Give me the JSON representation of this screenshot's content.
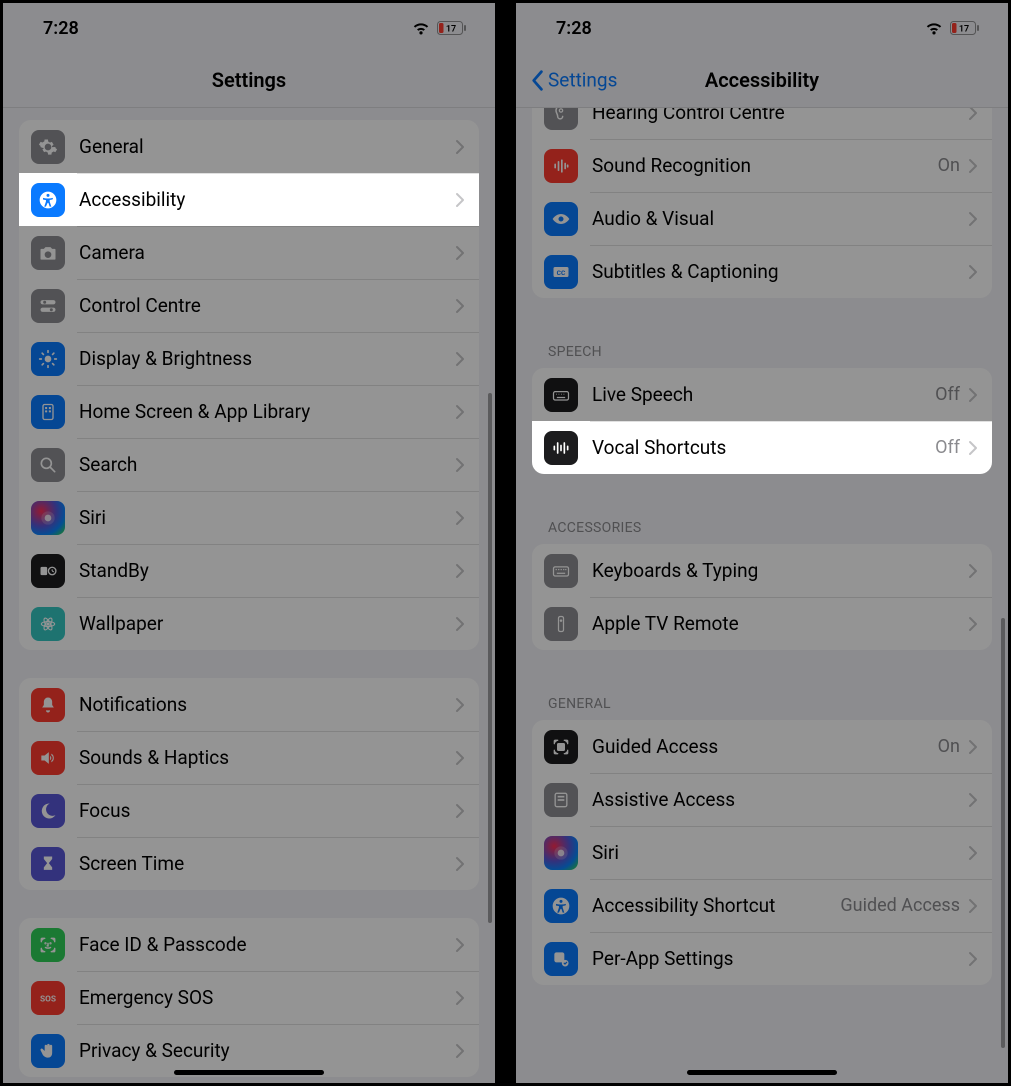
{
  "status": {
    "time": "7:28",
    "battery": "17"
  },
  "left": {
    "title": "Settings",
    "groups": [
      [
        {
          "icon": "gear",
          "color": "c-gray",
          "label": "General"
        },
        {
          "icon": "access",
          "color": "c-blue",
          "label": "Accessibility",
          "highlight": true
        },
        {
          "icon": "camera",
          "color": "c-gray",
          "label": "Camera"
        },
        {
          "icon": "toggles",
          "color": "c-gray",
          "label": "Control Centre"
        },
        {
          "icon": "brightness",
          "color": "c-blue",
          "label": "Display & Brightness"
        },
        {
          "icon": "home",
          "color": "c-blue",
          "label": "Home Screen & App Library"
        },
        {
          "icon": "search",
          "color": "c-gray",
          "label": "Search"
        },
        {
          "icon": "siri",
          "color": "c-siri",
          "label": "Siri"
        },
        {
          "icon": "standby",
          "color": "c-black",
          "label": "StandBy"
        },
        {
          "icon": "wallpaper",
          "color": "c-teal",
          "label": "Wallpaper"
        }
      ],
      [
        {
          "icon": "bell",
          "color": "c-red",
          "label": "Notifications"
        },
        {
          "icon": "speaker",
          "color": "c-red",
          "label": "Sounds & Haptics"
        },
        {
          "icon": "moon",
          "color": "c-purple",
          "label": "Focus"
        },
        {
          "icon": "hourglass",
          "color": "c-purple",
          "label": "Screen Time"
        }
      ],
      [
        {
          "icon": "faceid",
          "color": "c-green",
          "label": "Face ID & Passcode"
        },
        {
          "icon": "sos",
          "color": "c-red",
          "label": "Emergency SOS"
        },
        {
          "icon": "hand",
          "color": "c-blue",
          "label": "Privacy & Security"
        }
      ]
    ]
  },
  "right": {
    "back": "Settings",
    "title": "Accessibility",
    "sections": [
      {
        "header": null,
        "partial_top": true,
        "rows": [
          {
            "icon": "ear",
            "color": "c-gray",
            "label": "Hearing Control Centre"
          },
          {
            "icon": "soundrec",
            "color": "c-red",
            "label": "Sound Recognition",
            "value": "On"
          },
          {
            "icon": "eye",
            "color": "c-blue",
            "label": "Audio & Visual"
          },
          {
            "icon": "cc",
            "color": "c-blue",
            "label": "Subtitles & Captioning"
          }
        ]
      },
      {
        "header": "SPEECH",
        "rows": [
          {
            "icon": "keyboard-live",
            "color": "c-black",
            "label": "Live Speech",
            "value": "Off"
          },
          {
            "icon": "waveform",
            "color": "c-black",
            "label": "Vocal Shortcuts",
            "value": "Off",
            "highlight": true
          }
        ]
      },
      {
        "header": "ACCESSORIES",
        "rows": [
          {
            "icon": "keyboard",
            "color": "c-gray",
            "label": "Keyboards & Typing"
          },
          {
            "icon": "remote",
            "color": "c-gray",
            "label": "Apple TV Remote"
          }
        ]
      },
      {
        "header": "GENERAL",
        "rows": [
          {
            "icon": "guided",
            "color": "c-black",
            "label": "Guided Access",
            "value": "On"
          },
          {
            "icon": "assist",
            "color": "c-gray",
            "label": "Assistive Access"
          },
          {
            "icon": "siri",
            "color": "c-siri",
            "label": "Siri"
          },
          {
            "icon": "access",
            "color": "c-blue",
            "label": "Accessibility Shortcut",
            "value": "Guided Access"
          },
          {
            "icon": "perapp",
            "color": "c-blue",
            "label": "Per-App Settings"
          }
        ]
      }
    ]
  }
}
